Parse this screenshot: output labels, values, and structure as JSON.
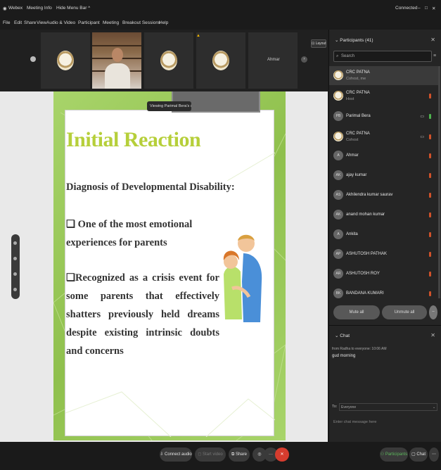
{
  "titlebar": {
    "app": "Webex",
    "meeting_info": "Meeting Info",
    "hide_menu": "Hide Menu Bar ^",
    "status": "Connected",
    "window_controls": [
      "|",
      "–",
      "□",
      "X"
    ]
  },
  "menu": [
    "File",
    "Edit",
    "Share",
    "View",
    "Audio & Video",
    "Participant",
    "Meeting",
    "Breakout Sessions",
    "Help"
  ],
  "strip": {
    "tiles": [
      {
        "kind": "logo"
      },
      {
        "kind": "video"
      },
      {
        "kind": "logo"
      },
      {
        "kind": "logo"
      },
      {
        "kind": "name",
        "name": "Ahmar"
      }
    ],
    "layout_label": "Layout"
  },
  "share": {
    "tooltip": "Viewing Parimal Bera's scre...",
    "slide": {
      "title": "Initial Reaction",
      "subtitle": "Diagnosis of Developmental Disability:",
      "bullet1": "❑ One of the most emotional experiences for parents",
      "bullet2": "❑Recognized as a crisis event for some parents that effectively shatters previously held dreams despite existing intrinsic doubts and concerns"
    }
  },
  "participants": {
    "header": "Participants (41)",
    "search_placeholder": "Search",
    "rows": [
      {
        "name": "CRC PATNA",
        "role": "Cohost, me",
        "avatar": "logo",
        "mic": "off"
      },
      {
        "name": "CRC PATNA",
        "role": "Host",
        "avatar": "logo",
        "mic": "off"
      },
      {
        "name": "Parimal Bera",
        "role": "",
        "avatar": "PB",
        "mic": "on"
      },
      {
        "name": "CRC PATNA",
        "role": "Cohost",
        "avatar": "logo",
        "mic": "off"
      },
      {
        "name": "Ahmar",
        "role": "",
        "avatar": "A",
        "mic": "off"
      },
      {
        "name": "ajay kumar",
        "role": "",
        "avatar": "AK",
        "mic": "off"
      },
      {
        "name": "Akhilendra kumar saurav",
        "role": "",
        "avatar": "AS",
        "mic": "off"
      },
      {
        "name": "anand mohan kumar",
        "role": "",
        "avatar": "AK",
        "mic": "off"
      },
      {
        "name": "Ankita",
        "role": "",
        "avatar": "A",
        "mic": "off"
      },
      {
        "name": "ASHUTOSH PATHAK",
        "role": "",
        "avatar": "AP",
        "mic": "off"
      },
      {
        "name": "ASHUTOSH ROY",
        "role": "",
        "avatar": "AR",
        "mic": "off"
      },
      {
        "name": "BANDANA KUMARI",
        "role": "",
        "avatar": "BK",
        "mic": "off"
      }
    ],
    "mute_all": "Mute all",
    "unmute_all": "Unmute all"
  },
  "chat": {
    "header": "Chat",
    "meta": "from Radha to everyone: 10:06 AM",
    "message": "gud morning",
    "to_label": "To:",
    "to_value": "Everyone",
    "input_placeholder": "Enter chat message here"
  },
  "bottombar": {
    "connect_audio": "Connect audio",
    "start_video": "Start video",
    "share": "Share",
    "participants": "Participants",
    "chat": "Chat",
    "more": "···"
  },
  "colors": {
    "slide_title": "#b6cf3a",
    "slide_bg": "#9ccc5c",
    "mic_muted": "#d0522a",
    "mic_on": "#4db34d",
    "end_call": "#d63c2e"
  }
}
